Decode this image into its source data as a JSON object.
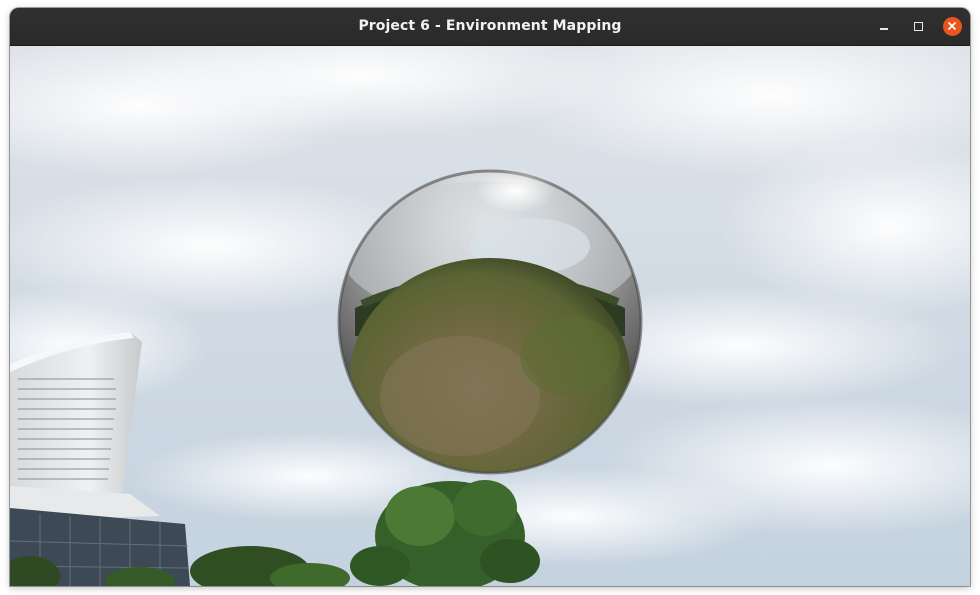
{
  "window": {
    "title": "Project 6 - Environment Mapping",
    "controls": {
      "minimize_icon": "minimize-icon",
      "maximize_icon": "maximize-icon",
      "close_icon": "close-icon"
    }
  },
  "scene": {
    "description_icons": [
      "sky-backdrop",
      "chrome-sphere",
      "tower-building",
      "trees"
    ],
    "colors": {
      "sky_top": "#d6dde6",
      "sky_bottom": "#c9d6e2",
      "cloud": "#f4f5f7",
      "grass": "#5e6b3a",
      "soil": "#7a6b4a",
      "chrome": "#c8c8c8",
      "close_button": "#e9541f"
    }
  }
}
